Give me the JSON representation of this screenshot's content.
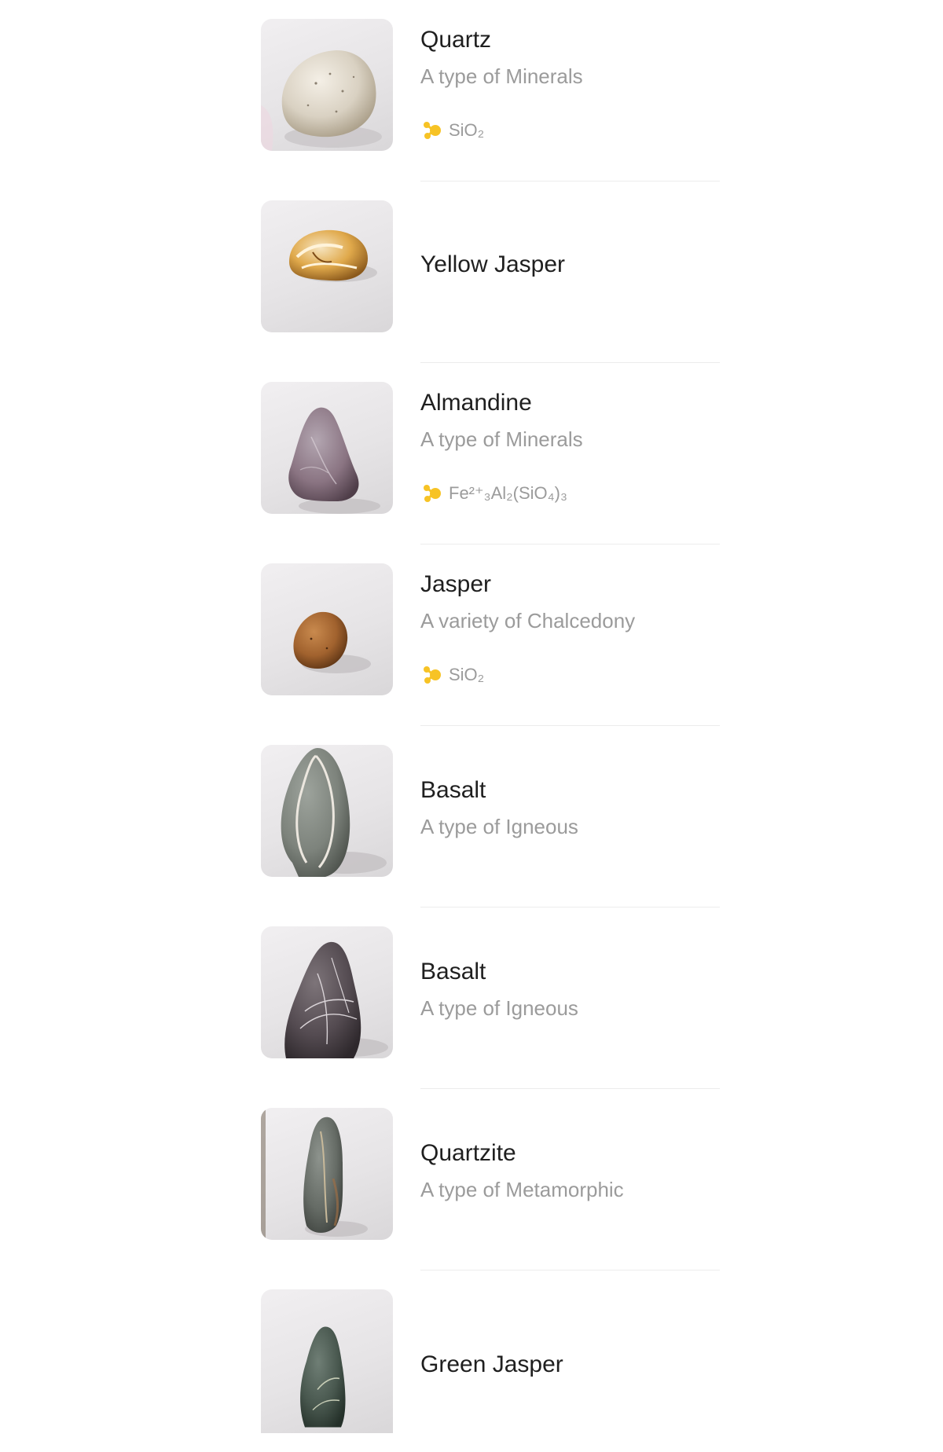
{
  "colors": {
    "title": "#1f1f1f",
    "subtitle": "#9b9b9b",
    "formula_icon": "#f7c325",
    "divider": "#ececec"
  },
  "rocks": [
    {
      "name": "Quartz",
      "subtitle": "A type of Minerals",
      "formula": "SiO₂",
      "icon": "molecule-icon",
      "thumb": "quartz-pebble-photo"
    },
    {
      "name": "Yellow Jasper",
      "subtitle": "",
      "formula": "",
      "icon": "",
      "thumb": "yellow-jasper-photo"
    },
    {
      "name": "Almandine",
      "subtitle": "A type of Minerals",
      "formula": "Fe²⁺₃Al₂(SiO₄)₃",
      "icon": "molecule-icon",
      "thumb": "almandine-photo"
    },
    {
      "name": "Jasper",
      "subtitle": "A variety of Chalcedony",
      "formula": "SiO₂",
      "icon": "molecule-icon",
      "thumb": "jasper-photo"
    },
    {
      "name": "Basalt",
      "subtitle": "A type of Igneous",
      "formula": "",
      "icon": "",
      "thumb": "basalt-banded-photo"
    },
    {
      "name": "Basalt",
      "subtitle": "A type of Igneous",
      "formula": "",
      "icon": "",
      "thumb": "basalt-veined-photo"
    },
    {
      "name": "Quartzite",
      "subtitle": "A type of Metamorphic",
      "formula": "",
      "icon": "",
      "thumb": "quartzite-photo"
    },
    {
      "name": "Green Jasper",
      "subtitle": "",
      "formula": "",
      "icon": "",
      "thumb": "green-jasper-photo"
    }
  ]
}
